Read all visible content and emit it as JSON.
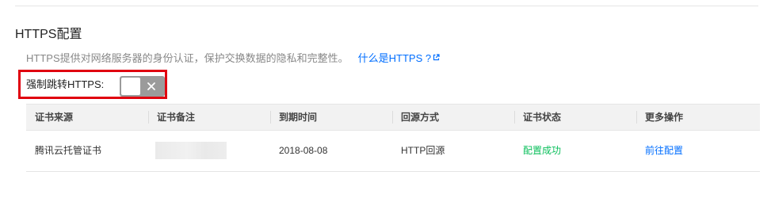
{
  "section": {
    "title": "HTTPS配置",
    "description": "HTTPS提供对网络服务器的身份认证，保护交换数据的隐私和完整性。",
    "help_link": "什么是HTTPS ?",
    "external_icon": "external-link-icon"
  },
  "force_redirect": {
    "label": "强制跳转HTTPS:",
    "enabled": false,
    "toggle_icon": "close-icon"
  },
  "table": {
    "columns": [
      "证书来源",
      "证书备注",
      "到期时间",
      "回源方式",
      "证书状态",
      "更多操作"
    ],
    "rows": [
      {
        "source": "腾讯云托管证书",
        "note": "",
        "expiry": "2018-08-08",
        "origin_method": "HTTP回源",
        "status": "配置成功",
        "action": "前往配置"
      }
    ]
  },
  "colors": {
    "link": "#006eff",
    "success": "#0abf5b",
    "highlight_box": "#e0000f",
    "toggle_off": "#9b9b9b"
  }
}
